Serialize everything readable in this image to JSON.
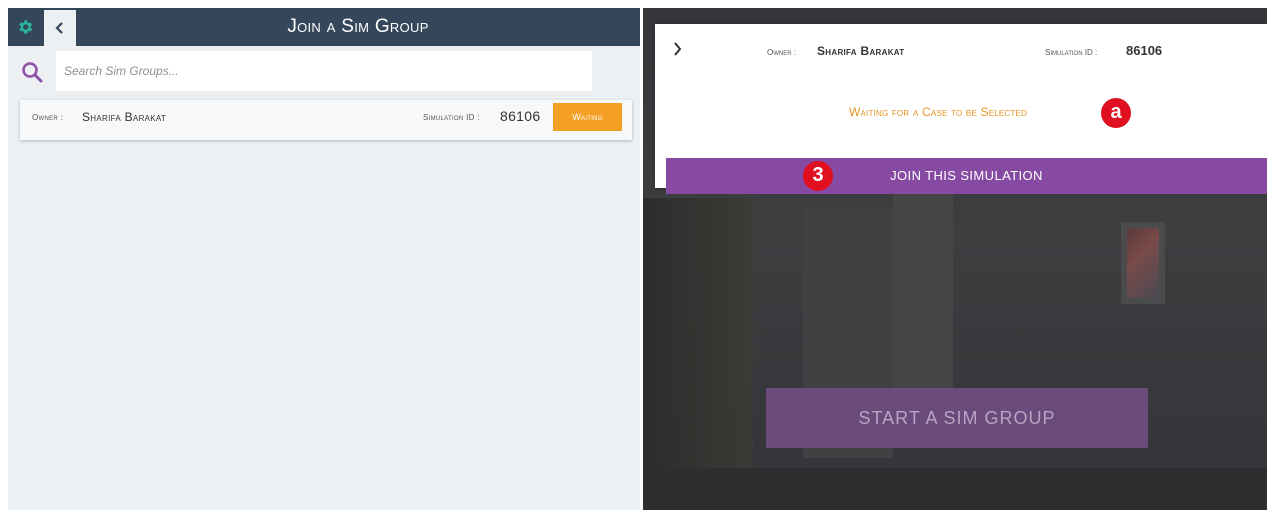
{
  "left": {
    "title": "Join a Sim Group",
    "search": {
      "placeholder": "Search Sim Groups..."
    },
    "groups": [
      {
        "owner_label": "Owner :",
        "owner_name": "Sharifa Barakat",
        "sim_label": "Simulation ID :",
        "sim_id": "86106",
        "status": "Waiting"
      }
    ]
  },
  "right": {
    "card": {
      "owner_label": "Owner :",
      "owner_name": "Sharifa Barakat",
      "sim_label": "Simulation ID :",
      "sim_id": "86106",
      "status_message": "Waiting for a Case to be Selected",
      "join_label": "JOIN THIS SIMULATION"
    },
    "start_label": "START A SIM GROUP"
  },
  "annotations": {
    "a": "a",
    "three": "3"
  },
  "colors": {
    "topbar": "#344659",
    "accent_teal": "#2ab39a",
    "waiting_orange": "#f4a025",
    "join_purple": "#874aa3",
    "marker_red": "#e01020",
    "search_purple": "#8e4fa8"
  },
  "icons": {
    "settings": "gear-icon",
    "back": "chevron-left-icon",
    "search": "search-icon",
    "expand": "chevron-right-icon"
  }
}
